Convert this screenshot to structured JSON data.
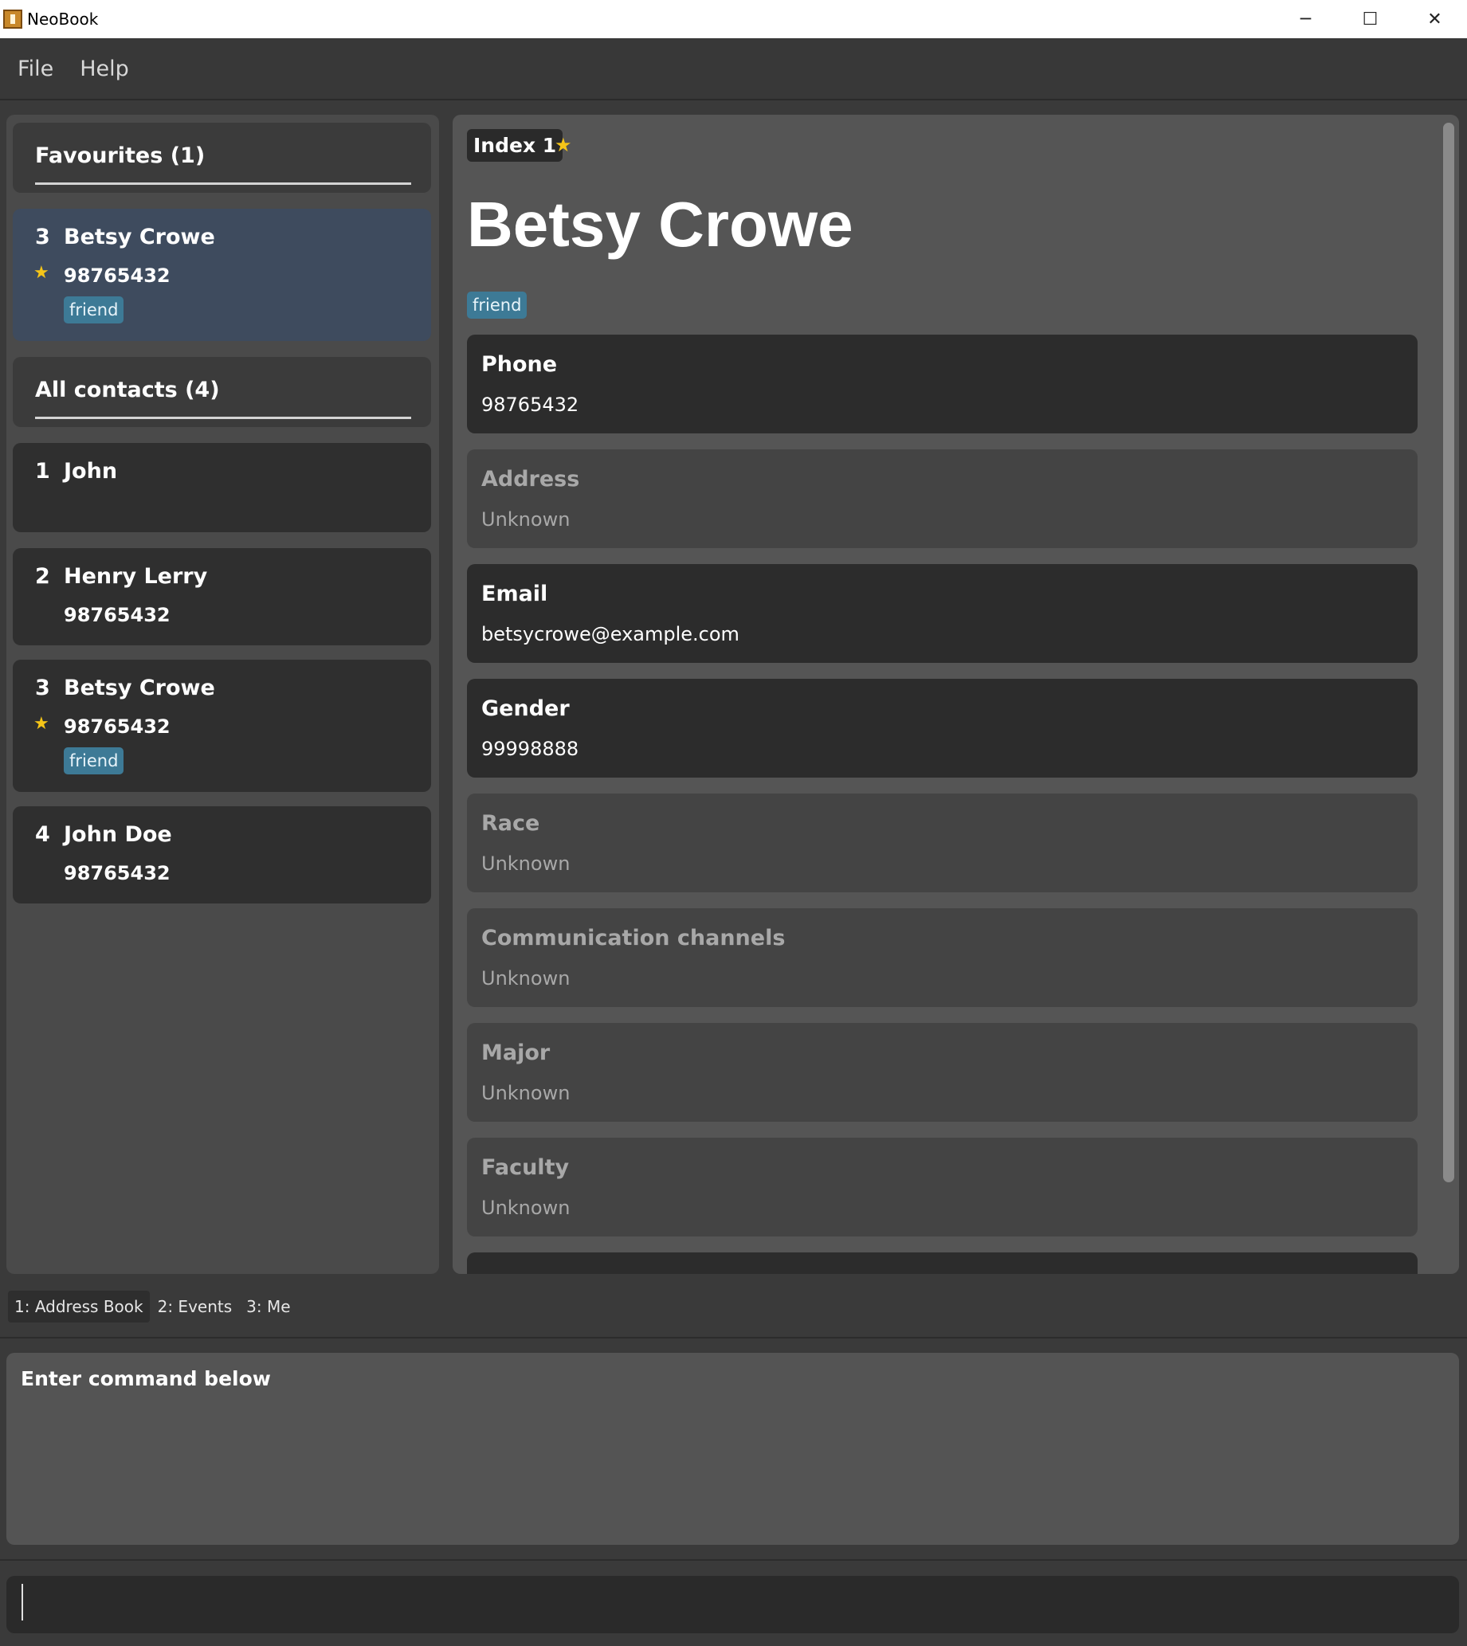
{
  "window": {
    "title": "NeoBook",
    "minimize_icon": "minimize-icon",
    "maximize_icon": "maximize-icon",
    "close_icon": "close-icon"
  },
  "menu": {
    "file": "File",
    "help": "Help"
  },
  "favourites": {
    "header": "Favourites (1)",
    "items": [
      {
        "index": "3",
        "name": "Betsy Crowe",
        "phone": "98765432",
        "favourite": true,
        "tag": "friend"
      }
    ]
  },
  "all_contacts": {
    "header": "All contacts (4)",
    "items": [
      {
        "index": "1",
        "name": "John",
        "phone": "",
        "favourite": false,
        "tag": ""
      },
      {
        "index": "2",
        "name": "Henry Lerry",
        "phone": "98765432",
        "favourite": false,
        "tag": ""
      },
      {
        "index": "3",
        "name": "Betsy Crowe",
        "phone": "98765432",
        "favourite": true,
        "tag": "friend"
      },
      {
        "index": "4",
        "name": "John Doe",
        "phone": "98765432",
        "favourite": false,
        "tag": ""
      }
    ]
  },
  "detail": {
    "index_label": "Index 1",
    "favourite": true,
    "name": "Betsy Crowe",
    "tag": "friend",
    "fields": [
      {
        "label": "Phone",
        "value": "98765432",
        "known": true
      },
      {
        "label": "Address",
        "value": "Unknown",
        "known": false
      },
      {
        "label": "Email",
        "value": "betsycrowe@example.com",
        "known": true
      },
      {
        "label": "Gender",
        "value": "99998888",
        "known": true
      },
      {
        "label": "Race",
        "value": "Unknown",
        "known": false
      },
      {
        "label": "Communication channels",
        "value": "Unknown",
        "known": false
      },
      {
        "label": "Major",
        "value": "Unknown",
        "known": false
      },
      {
        "label": "Faculty",
        "value": "Unknown",
        "known": false
      }
    ]
  },
  "tabs": [
    "1: Address Book",
    "2: Events",
    "3: Me"
  ],
  "active_tab": "1: Address Book",
  "result_display": {
    "text": "Enter command below"
  },
  "command_box": {
    "value": ""
  },
  "colors": {
    "accent_tag": "#3d7a96",
    "star": "#f5c518",
    "selected_card": "#3e4b5e"
  }
}
